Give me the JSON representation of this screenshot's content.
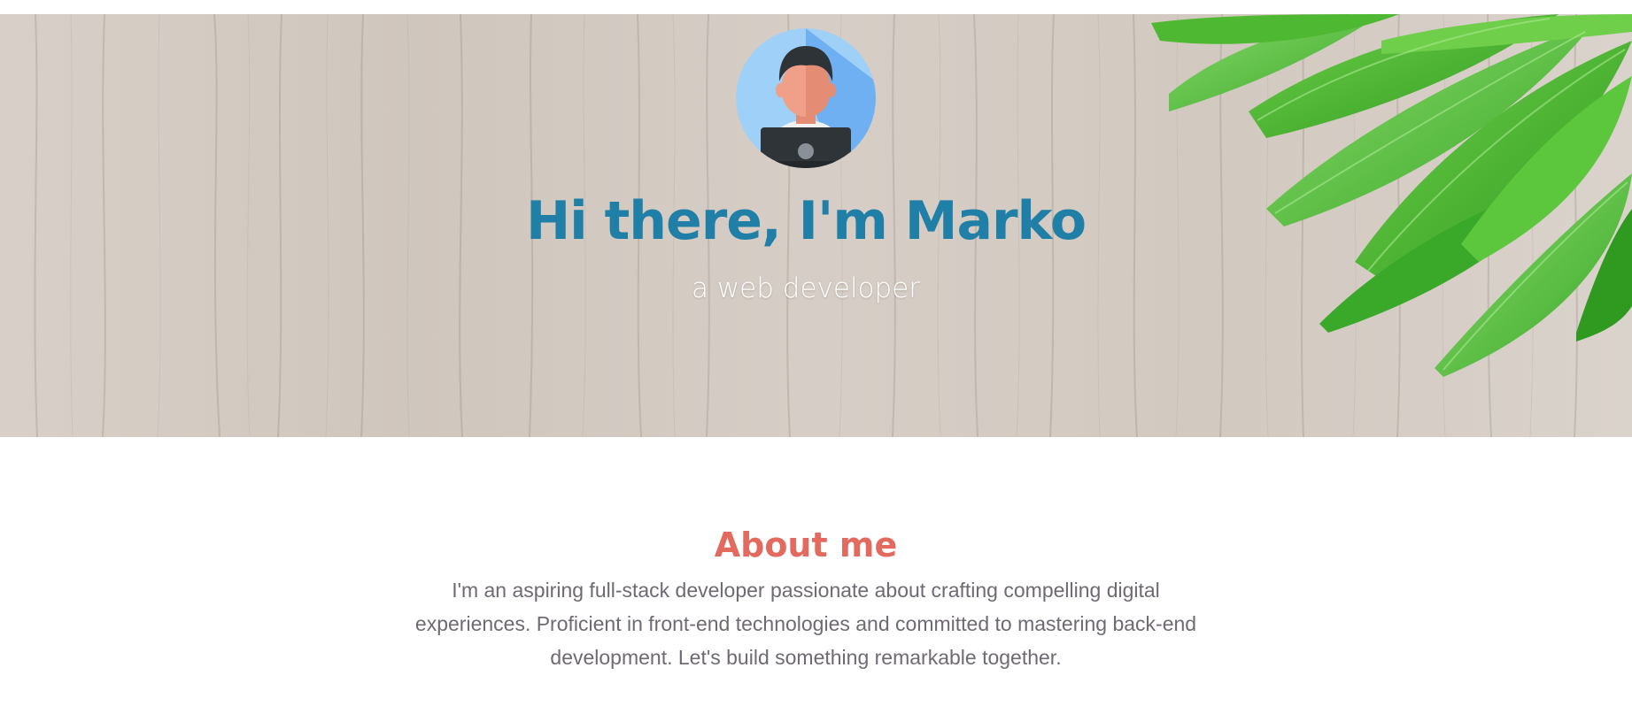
{
  "hero": {
    "title": "Hi there, I'm Marko",
    "subtitle": "a web developer",
    "avatar_icon": "developer-avatar-icon",
    "background": "wood-texture-with-leaves"
  },
  "about": {
    "heading": "About me",
    "text": "I'm an aspiring full-stack developer passionate about crafting compelling digital experiences. Proficient in front-end technologies and committed to mastering back-end development. Let's build something remarkable together."
  },
  "colors": {
    "title_blue": "#1f7fa6",
    "heading_coral": "#e36a5f",
    "body_gray": "#6f6a72",
    "avatar_bg": "#8fc6f5"
  }
}
